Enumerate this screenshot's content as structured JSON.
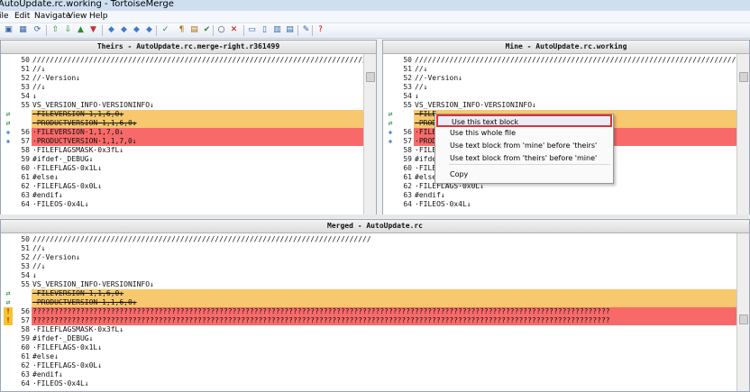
{
  "window": {
    "title": "AutoUpdate.rc.working - TortoiseMerge"
  },
  "menu": [
    "ile",
    "Edit",
    "Navigate",
    "View",
    "Help"
  ],
  "toolbar": [
    {
      "icon": "save-icon",
      "glyph": "▣",
      "color": "#3464a8"
    },
    {
      "icon": "open-icon",
      "glyph": "▦",
      "color": "#3464a8"
    },
    {
      "icon": "reload-icon",
      "glyph": "⟳",
      "color": "#3464a8"
    },
    {
      "icon": "prev-file-icon",
      "glyph": "⇧",
      "color": "#2b8a2b"
    },
    {
      "icon": "next-file-icon",
      "glyph": "⇩",
      "color": "#2b8a2b"
    },
    {
      "icon": "prev-diff-icon",
      "glyph": "▲",
      "color": "#2b8a2b"
    },
    {
      "icon": "next-diff-icon",
      "glyph": "▼",
      "color": "#c03030"
    },
    {
      "icon": "nav-left-icon",
      "glyph": "◆",
      "color": "#3a7bd5"
    },
    {
      "icon": "nav-right-icon",
      "glyph": "◆",
      "color": "#3a7bd5"
    },
    {
      "icon": "nav-up-icon",
      "glyph": "◆",
      "color": "#3a7bd5"
    },
    {
      "icon": "nav-down-icon",
      "glyph": "◆",
      "color": "#3a7bd5"
    },
    {
      "icon": "check-icon",
      "glyph": "✓",
      "color": "#2b8a2b"
    },
    {
      "icon": "paragraph-icon",
      "glyph": "¶",
      "color": "#b06d00"
    },
    {
      "icon": "whitespace-icon",
      "glyph": "▤",
      "color": "#b06d00"
    },
    {
      "icon": "mark-resolved-icon",
      "glyph": "✔",
      "color": "#2b8a2b"
    },
    {
      "icon": "circle-icon",
      "glyph": "○",
      "color": "#333"
    },
    {
      "icon": "close-icon",
      "glyph": "✕",
      "color": "#c00"
    },
    {
      "icon": "view-one-icon",
      "glyph": "▭",
      "color": "#3464a8"
    },
    {
      "icon": "view-two-icon",
      "glyph": "▯",
      "color": "#3464a8"
    },
    {
      "icon": "view-three-icon",
      "glyph": "▥",
      "color": "#3464a8"
    },
    {
      "icon": "layout-icon",
      "glyph": "▤",
      "color": "#3464a8"
    },
    {
      "icon": "edit-icon",
      "glyph": "✎",
      "color": "#3464a8"
    },
    {
      "icon": "help-icon",
      "glyph": "?",
      "color": "#c00"
    }
  ],
  "theirs": {
    "title": "Theirs - AutoUpdate.rc.merge-right.r361499",
    "lines": [
      {
        "n": "50",
        "t": "//////////////////////////////////////////////////////////////////////////////",
        "s": ""
      },
      {
        "n": "51",
        "t": "//↓",
        "s": ""
      },
      {
        "n": "52",
        "t": "//·Version↓",
        "s": ""
      },
      {
        "n": "53",
        "t": "//↓",
        "s": ""
      },
      {
        "n": "54",
        "t": "↓",
        "s": ""
      },
      {
        "n": "55",
        "t": "VS_VERSION_INFO·VERSIONINFO↓",
        "s": ""
      },
      {
        "n": "",
        "t": "·FILEVERSION·1,1,6,0↓",
        "s": "conflict strike",
        "mk": "⇄"
      },
      {
        "n": "",
        "t": "·PRODUCTVERSION·1,1,6,0↓",
        "s": "conflict strike",
        "mk": "⇄"
      },
      {
        "n": "56",
        "t": "·FILEVERSION·1,1,7,0↓",
        "s": "changed",
        "mk": "✚"
      },
      {
        "n": "57",
        "t": "·PRODUCTVERSION·1,1,7,0↓",
        "s": "changed",
        "mk": "✚"
      },
      {
        "n": "58",
        "t": "·FILEFLAGSMASK·0x3fL↓",
        "s": ""
      },
      {
        "n": "59",
        "t": "#ifdef·_DEBUG↓",
        "s": ""
      },
      {
        "n": "60",
        "t": "·FILEFLAGS·0x1L↓",
        "s": ""
      },
      {
        "n": "61",
        "t": "#else↓",
        "s": ""
      },
      {
        "n": "62",
        "t": "·FILEFLAGS·0x0L↓",
        "s": ""
      },
      {
        "n": "63",
        "t": "#endif↓",
        "s": ""
      },
      {
        "n": "64",
        "t": "·FILEOS·0x4L↓",
        "s": ""
      }
    ]
  },
  "mine": {
    "title": "Mine - AutoUpdate.rc.working",
    "lines": [
      {
        "n": "50",
        "t": "//////////////////////////////////////////////////////////////////////////////",
        "s": ""
      },
      {
        "n": "51",
        "t": "//↓",
        "s": ""
      },
      {
        "n": "52",
        "t": "//·Version↓",
        "s": ""
      },
      {
        "n": "53",
        "t": "//↓",
        "s": ""
      },
      {
        "n": "54",
        "t": "↓",
        "s": ""
      },
      {
        "n": "55",
        "t": "VS_VERSION_INFO·VERSIONINFO↓",
        "s": ""
      },
      {
        "n": "",
        "t": "·FILE",
        "s": "conflict strike",
        "mk": "⇄"
      },
      {
        "n": "",
        "t": "·PROD",
        "s": "conflict strike",
        "mk": "⇄"
      },
      {
        "n": "56",
        "t": "·FILE",
        "s": "changed",
        "mk": "✚"
      },
      {
        "n": "57",
        "t": "·PROD",
        "s": "changed",
        "mk": "✚"
      },
      {
        "n": "58",
        "t": "·FILE",
        "s": ""
      },
      {
        "n": "59",
        "t": "#ifde",
        "s": ""
      },
      {
        "n": "60",
        "t": "·FILE",
        "s": ""
      },
      {
        "n": "61",
        "t": "#else↓",
        "s": ""
      },
      {
        "n": "62",
        "t": "·FILEFLAGS·0x0L↓",
        "s": ""
      },
      {
        "n": "63",
        "t": "#endif↓",
        "s": ""
      },
      {
        "n": "64",
        "t": "·FILEOS·0x4L↓",
        "s": ""
      }
    ]
  },
  "merged": {
    "title": "Merged - AutoUpdate.rc",
    "lines": [
      {
        "n": "50",
        "t": "//////////////////////////////////////////////////////////////////////////////",
        "s": ""
      },
      {
        "n": "51",
        "t": "//↓",
        "s": ""
      },
      {
        "n": "52",
        "t": "//·Version↓",
        "s": ""
      },
      {
        "n": "53",
        "t": "//↓",
        "s": ""
      },
      {
        "n": "54",
        "t": "↓",
        "s": ""
      },
      {
        "n": "55",
        "t": "VS_VERSION_INFO·VERSIONINFO↓",
        "s": ""
      },
      {
        "n": "",
        "t": "·FILEVERSION·1,1,6,0↓",
        "s": "conflict strike",
        "mk": "⇄"
      },
      {
        "n": "",
        "t": "·PRODUCTVERSION·1,1,6,0↓",
        "s": "conflict strike",
        "mk": "⇄"
      },
      {
        "n": "56",
        "t": "?????????????????????????????????????????????????????????????????????????????????????????????????????????????????????????????????????",
        "s": "mconf",
        "mk": "!"
      },
      {
        "n": "57",
        "t": "?????????????????????????????????????????????????????????????????????????????????????????????????????????????????????????????????????",
        "s": "mconf",
        "mk": "!"
      },
      {
        "n": "58",
        "t": "·FILEFLAGSMASK·0x3fL↓",
        "s": ""
      },
      {
        "n": "59",
        "t": "#ifdef·_DEBUG↓",
        "s": ""
      },
      {
        "n": "60",
        "t": "·FILEFLAGS·0x1L↓",
        "s": ""
      },
      {
        "n": "61",
        "t": "#else↓",
        "s": ""
      },
      {
        "n": "62",
        "t": "·FILEFLAGS·0x0L↓",
        "s": ""
      },
      {
        "n": "63",
        "t": "#endif↓",
        "s": ""
      },
      {
        "n": "64",
        "t": "·FILEOS·0x4L↓",
        "s": ""
      }
    ]
  },
  "context_menu": {
    "items": [
      "Use this text block",
      "Use this whole file",
      "Use text block from 'mine' before 'theirs'",
      "Use text block from 'theirs' before 'mine'",
      "Copy"
    ]
  }
}
